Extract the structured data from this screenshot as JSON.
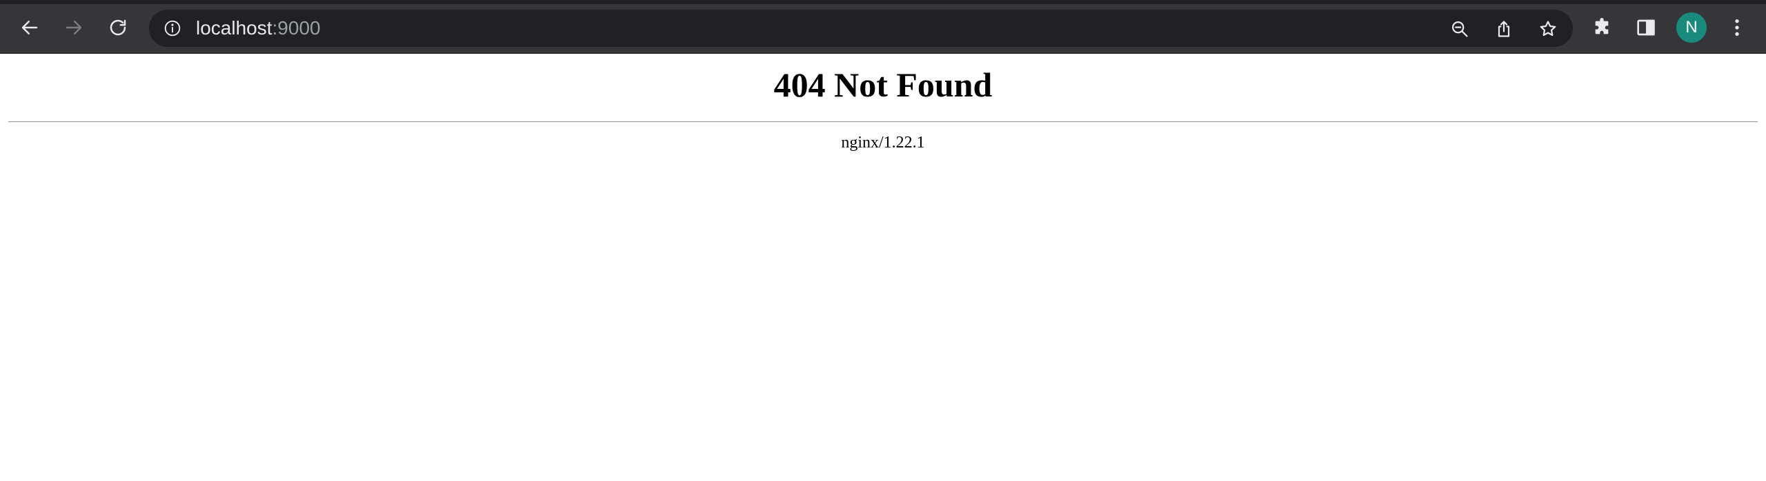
{
  "browser": {
    "address_bar": {
      "host": "localhost",
      "port": ":9000"
    },
    "profile_initial": "N",
    "icons": {
      "back": "arrow-left-icon",
      "forward": "arrow-right-icon",
      "reload": "reload-icon",
      "site_info": "info-icon",
      "zoom": "zoom-out-icon",
      "share": "share-icon",
      "bookmark": "star-icon",
      "extensions": "puzzle-icon",
      "side_panel": "side-panel-icon",
      "menu": "kebab-menu-icon"
    },
    "colors": {
      "toolbar": "#35363a",
      "omnibox": "#202124",
      "avatar": "#1a8a7c"
    }
  },
  "page": {
    "heading": "404 Not Found",
    "server": "nginx/1.22.1"
  }
}
